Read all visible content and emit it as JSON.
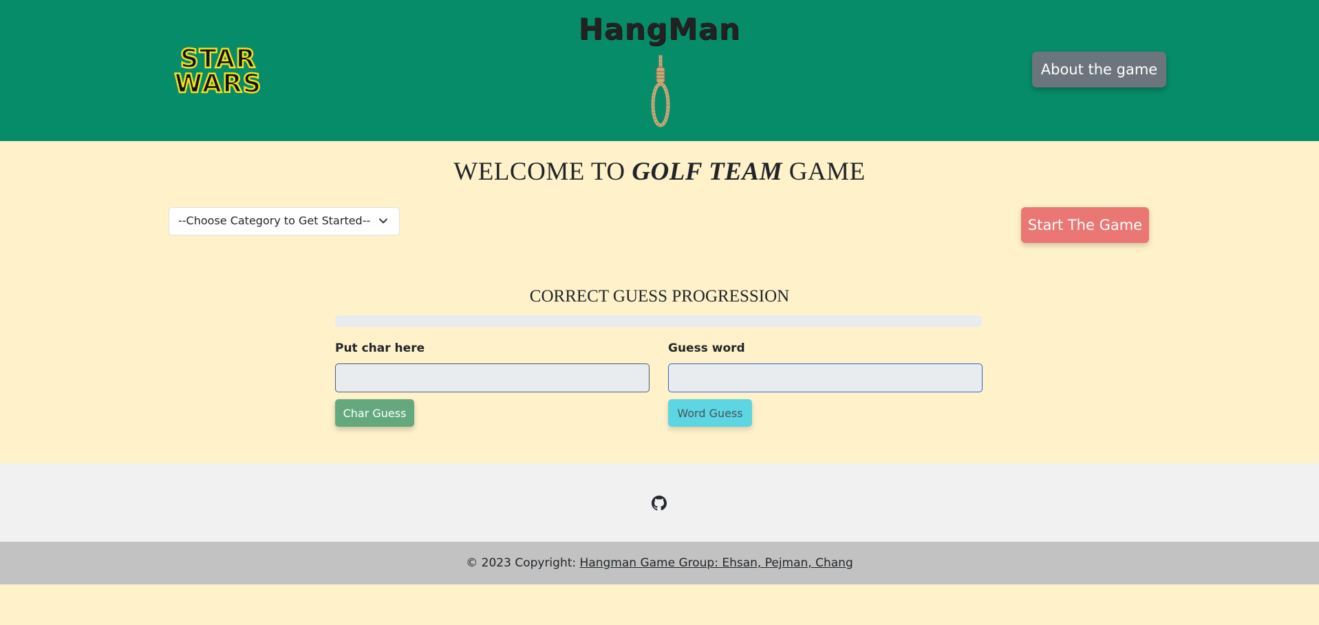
{
  "header": {
    "logo_text_line1": "STAR",
    "logo_text_line2": "WARS",
    "title": "HangMan",
    "about_button": "About the game"
  },
  "welcome": {
    "prefix": "WELCOME TO",
    "emphasis": "GOLF TEAM",
    "suffix": "GAME"
  },
  "category_select": {
    "selected": "--Choose Category to Get Started--"
  },
  "start_button": "Start The Game",
  "progress": {
    "title": "CORRECT GUESS PROGRESSION",
    "value_percent": 0
  },
  "char_input": {
    "label": "Put char here",
    "value": "",
    "button": "Char Guess"
  },
  "word_input": {
    "label": "Guess word",
    "value": "",
    "button": "Word Guess"
  },
  "footer": {
    "github_icon": "github-icon",
    "copyright_prefix": "© 2023 Copyright:",
    "copyright_link": "Hangman Game Group: Ehsan, Pejman, Chang"
  },
  "colors": {
    "header_bg": "#078c69",
    "page_bg": "#fff2ca",
    "start_button": "#ea7773",
    "char_button": "#64a97d",
    "word_button": "#5cd6e2",
    "about_button": "#6c757d"
  }
}
